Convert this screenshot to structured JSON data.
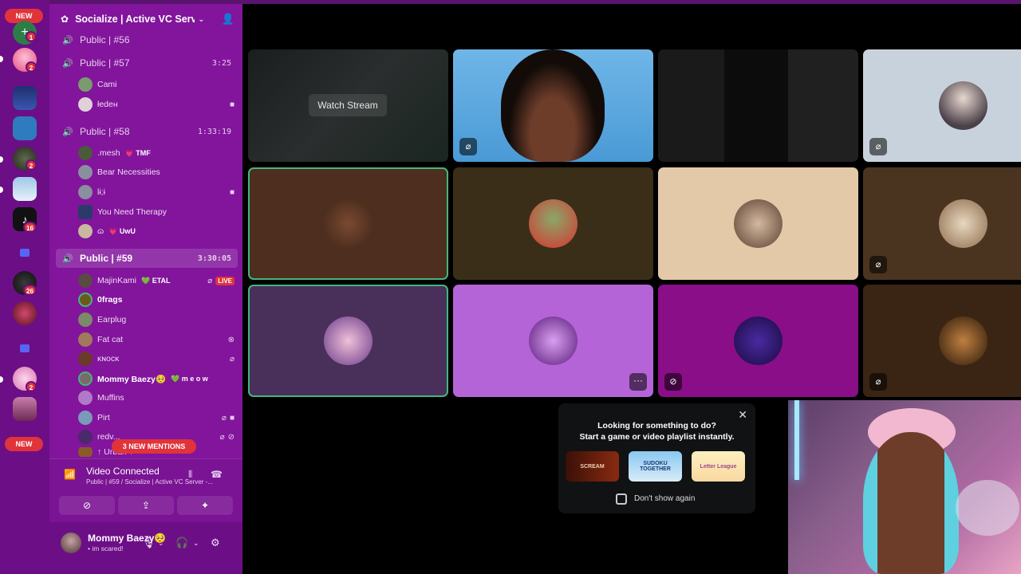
{
  "colors": {
    "rail": "#6c0e86",
    "sidebar": "#82159c",
    "badge": "#e0333a",
    "speaking": "#43b581"
  },
  "rail": {
    "new_top": "NEW",
    "new_bottom": "NEW",
    "badges": [
      "1",
      "2",
      "2",
      "16",
      "26",
      "2"
    ]
  },
  "server": {
    "name": "Socialize | Active VC Serv...",
    "dropdown_icon": "chevron-down-icon",
    "invite_icon": "add-user-icon"
  },
  "channels": [
    {
      "name": "Public | #56",
      "time": ""
    },
    {
      "name": "Public | #57",
      "time": "3:25"
    },
    {
      "name": "Public | #58",
      "time": "1:33:19"
    },
    {
      "name": "Public | #59",
      "time": "3:30:05"
    }
  ],
  "ch57_users": [
    "Cami",
    "łedeн"
  ],
  "ch58_users": [
    ".mesh",
    "Bear Necessities",
    "lɨ;ɨ",
    "You Need Therapy",
    "ɷ"
  ],
  "ch58_tags": {
    "mesh": "💗 TMF",
    "u5": "💗 UwU"
  },
  "ch59_users": [
    "MajinKami",
    "0frags",
    "Earplug",
    "Fat cat",
    "ĸɴocĸ",
    "Mommy Baezy🥺",
    "Muffins",
    "Pirt",
    "redv...",
    "↑ Urban ↑"
  ],
  "ch59_tags": {
    "majin": "💚 ETAL",
    "baezy": "💚 m e o w"
  },
  "live_label": "LIVE",
  "mentions_label": "3 NEW MENTIONS",
  "voice": {
    "status": "Video Connected",
    "sub": "Public | #59 / Socialize | Active VC Server -..."
  },
  "user": {
    "name": "Mommy Baezy🥺",
    "status": "• im scared!"
  },
  "grid": {
    "watch_stream": "Watch Stream",
    "more": "···"
  },
  "popup": {
    "line1": "Looking for something to do?",
    "line2": "Start a game or video playlist instantly.",
    "games": [
      "SCREAM",
      "SUDOKU TOGETHER",
      "Letter League"
    ],
    "dont_show": "Don't show again",
    "close": "✕"
  }
}
